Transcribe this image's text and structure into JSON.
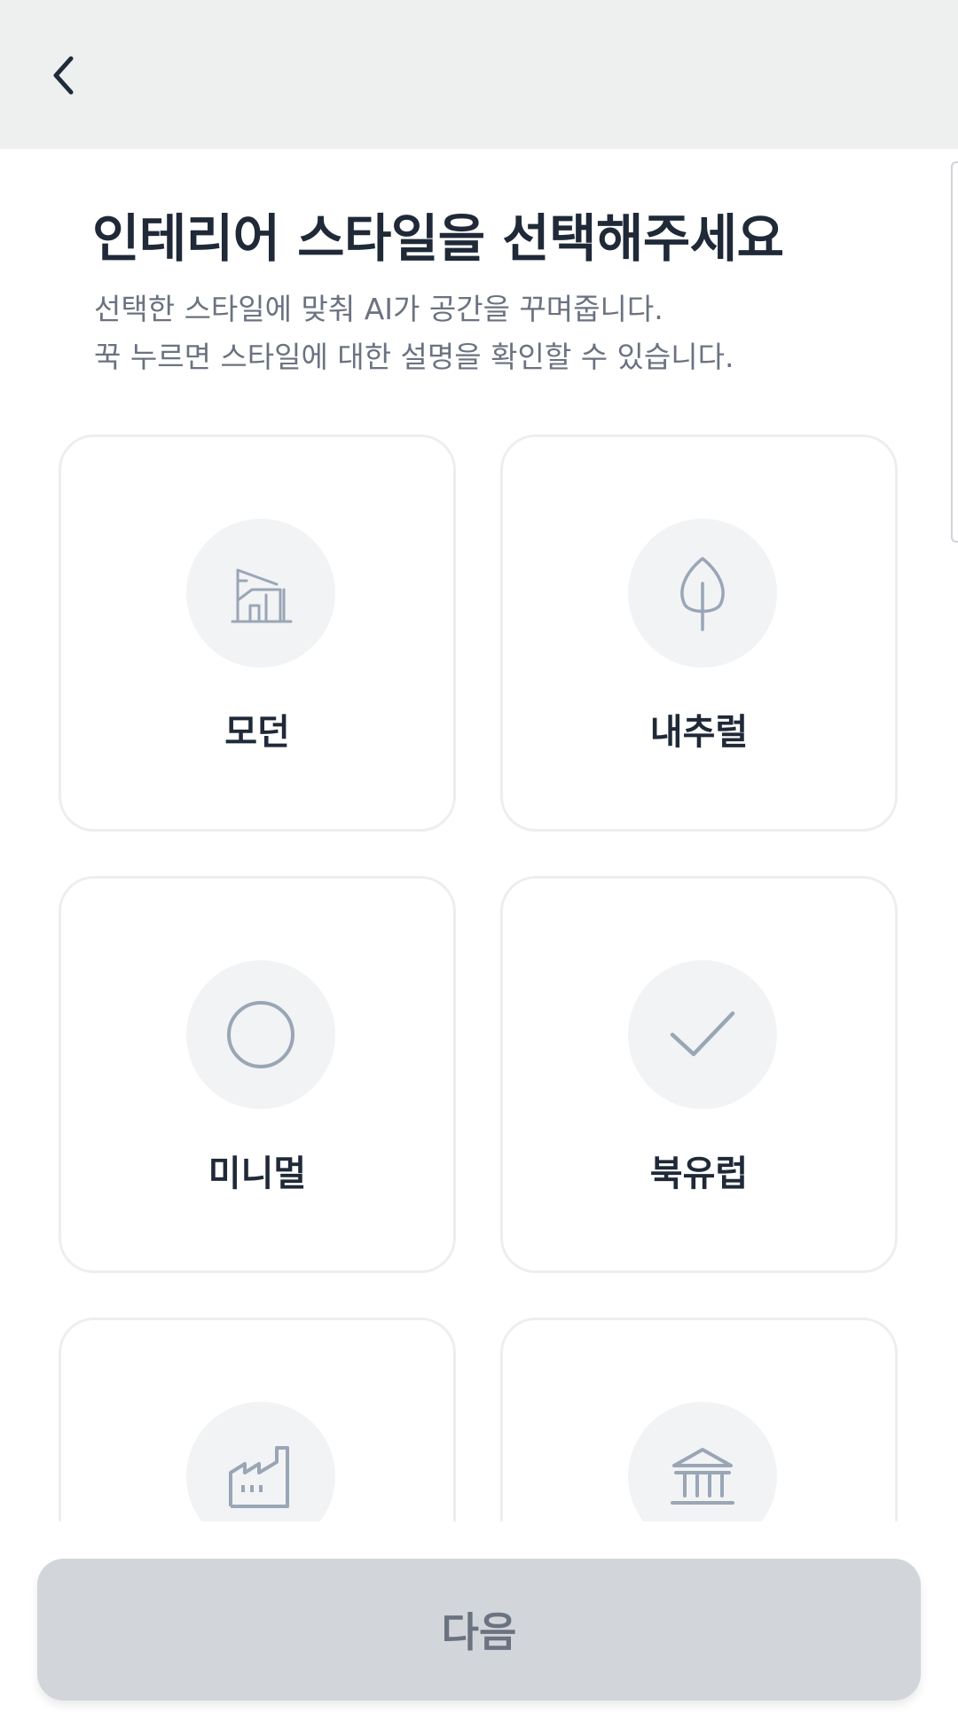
{
  "header": {
    "back_icon": "chevron-left-icon"
  },
  "title": "인테리어 스타일을 선택해주세요",
  "subtitle": {
    "line1": "선택한 스타일에 맞춰 AI가 공간을 꾸며줍니다.",
    "line2": "꾹 누르면 스타일에 대한 설명을 확인할 수 있습니다."
  },
  "styles": [
    {
      "label": "모던",
      "icon": "modern-house-icon"
    },
    {
      "label": "내추럴",
      "icon": "leaf-icon"
    },
    {
      "label": "미니멀",
      "icon": "circle-icon"
    },
    {
      "label": "북유럽",
      "icon": "check-icon"
    },
    {
      "label": "",
      "icon": "factory-icon"
    },
    {
      "label": "",
      "icon": "classic-building-icon"
    }
  ],
  "next_button": {
    "label": "다음"
  },
  "colors": {
    "icon_stroke": "#9aa6b5",
    "button_bg": "#d2d5da",
    "card_border": "#eceef1"
  }
}
